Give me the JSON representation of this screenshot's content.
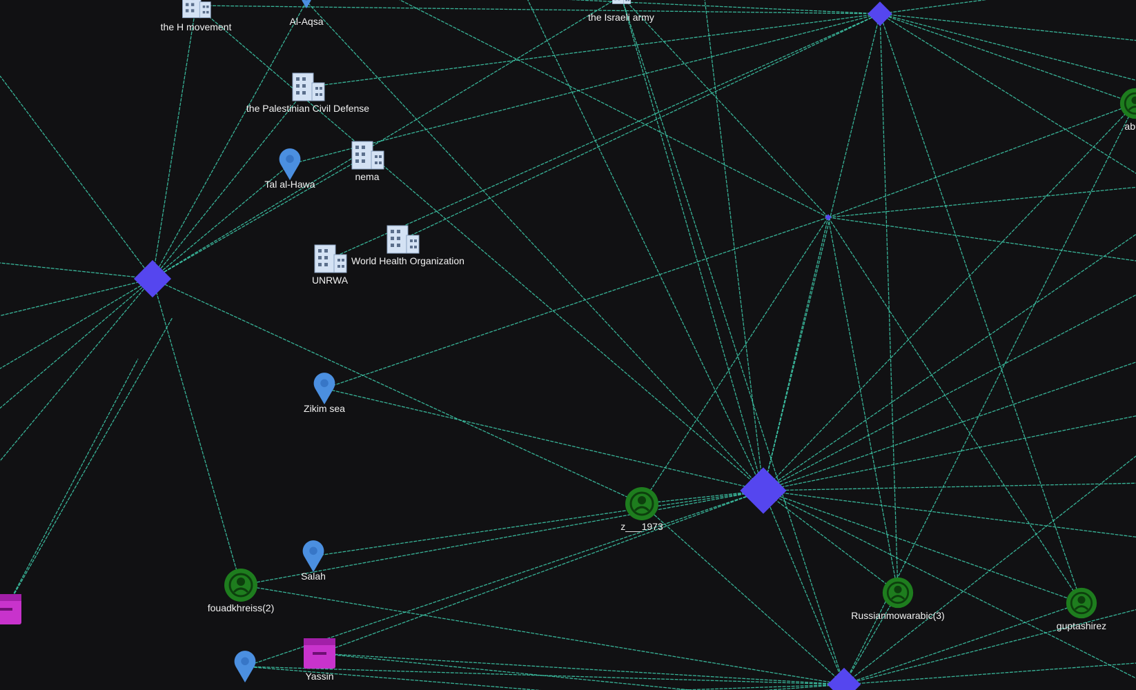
{
  "colors": {
    "background": "#111113",
    "edge": "#3fd1b0",
    "hub": "#5546ef",
    "person": "#1e7d1e",
    "location": "#4b8fe0",
    "organization": "#d4e2f4",
    "event": "#c833cc"
  },
  "nodes": [
    {
      "id": "n1",
      "kind": "organization",
      "label": "the H movement",
      "icon": "building-icon"
    },
    {
      "id": "n2",
      "kind": "location",
      "label": "Al-Aqsa",
      "icon": "map-pin-icon"
    },
    {
      "id": "n3",
      "kind": "organization",
      "label": "the Palestinian Civil Defense",
      "icon": "building-icon"
    },
    {
      "id": "n4",
      "kind": "location",
      "label": "Tal al-Hawa",
      "icon": "map-pin-icon"
    },
    {
      "id": "n5",
      "kind": "organization",
      "label": "nema",
      "icon": "building-icon"
    },
    {
      "id": "n6",
      "kind": "organization",
      "label": "UNRWA",
      "icon": "building-icon"
    },
    {
      "id": "n7",
      "kind": "organization",
      "label": "World Health Organization",
      "icon": "building-icon"
    },
    {
      "id": "n8",
      "kind": "location",
      "label": "Zikim sea",
      "icon": "map-pin-icon"
    },
    {
      "id": "n9",
      "kind": "person",
      "label": "z___1973",
      "icon": "person-icon"
    },
    {
      "id": "n10",
      "kind": "location",
      "label": "Salah",
      "icon": "map-pin-icon"
    },
    {
      "id": "n11",
      "kind": "person",
      "label": "fouadkhreiss(2)",
      "icon": "person-icon"
    },
    {
      "id": "n12",
      "kind": "event",
      "label": "Yassin",
      "icon": "calendar-icon"
    },
    {
      "id": "n13",
      "kind": "location",
      "label": "",
      "icon": "map-pin-icon"
    },
    {
      "id": "n14",
      "kind": "person",
      "label": "Russianmowarabic(3)",
      "icon": "person-icon"
    },
    {
      "id": "n15",
      "kind": "person",
      "label": "guptashirez",
      "icon": "person-icon"
    },
    {
      "id": "n16",
      "kind": "person",
      "label": "abuh",
      "icon": "person-icon"
    },
    {
      "id": "n17",
      "kind": "organization",
      "label": "the Israeli army",
      "icon": "building-icon"
    },
    {
      "id": "n18",
      "kind": "event",
      "label": "",
      "icon": "calendar-icon"
    },
    {
      "id": "h1",
      "kind": "hub",
      "label": "",
      "icon": "diamond-icon"
    },
    {
      "id": "h2",
      "kind": "hub",
      "label": "",
      "icon": "diamond-icon"
    },
    {
      "id": "h3",
      "kind": "hub",
      "label": "",
      "icon": "diamond-icon"
    },
    {
      "id": "h4",
      "kind": "hub",
      "label": "",
      "icon": "diamond-icon"
    },
    {
      "id": "h5",
      "kind": "hub",
      "label": "",
      "icon": "diamond-icon"
    }
  ],
  "edges": [
    [
      "h1",
      "n3"
    ],
    [
      "h1",
      "n4"
    ],
    [
      "h1",
      "n5"
    ],
    [
      "h1",
      "n11"
    ],
    [
      "h1",
      "n9"
    ],
    [
      "h1",
      "n1"
    ],
    [
      "h1",
      "n17"
    ],
    [
      "h1",
      "n2"
    ],
    [
      "h2",
      "n9"
    ],
    [
      "h2",
      "n10"
    ],
    [
      "h2",
      "n11"
    ],
    [
      "h2",
      "n12"
    ],
    [
      "h2",
      "n13"
    ],
    [
      "h2",
      "n14"
    ],
    [
      "h2",
      "n15"
    ],
    [
      "h2",
      "n16"
    ],
    [
      "h2",
      "n8"
    ],
    [
      "h2",
      "n2"
    ],
    [
      "h2",
      "n17"
    ],
    [
      "h2",
      "n1"
    ],
    [
      "h2",
      "h3"
    ],
    [
      "h2",
      "h5"
    ],
    [
      "h2",
      "h4"
    ],
    [
      "h3",
      "n16"
    ],
    [
      "h3",
      "n7"
    ],
    [
      "h3",
      "n3"
    ],
    [
      "h3",
      "n1"
    ],
    [
      "h3",
      "n14"
    ],
    [
      "h3",
      "n15"
    ],
    [
      "h3",
      "n6"
    ],
    [
      "h3",
      "n4"
    ],
    [
      "h4",
      "n8"
    ],
    [
      "h4",
      "n16"
    ],
    [
      "h4",
      "n17"
    ],
    [
      "h4",
      "n9"
    ],
    [
      "h4",
      "n14"
    ],
    [
      "h4",
      "n15"
    ],
    [
      "h5",
      "n14"
    ],
    [
      "h5",
      "n15"
    ],
    [
      "h5",
      "n11"
    ],
    [
      "h5",
      "n13"
    ],
    [
      "h5",
      "n9"
    ],
    [
      "h5",
      "n16"
    ],
    [
      "h5",
      "n17"
    ],
    [
      "h5",
      "n12"
    ]
  ]
}
